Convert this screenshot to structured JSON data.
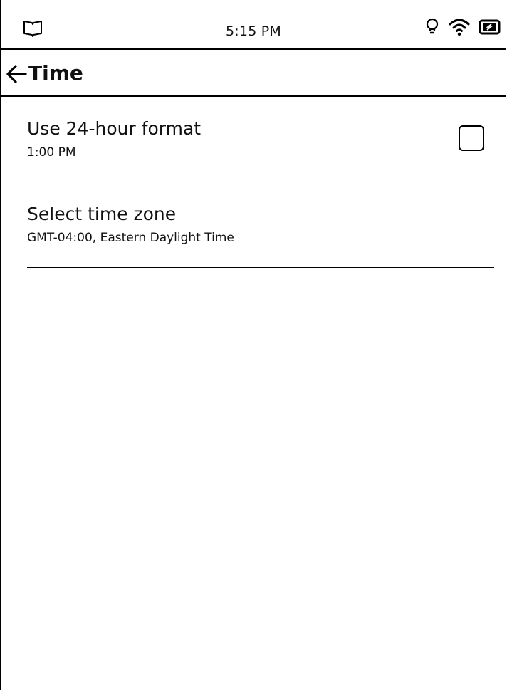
{
  "status_bar": {
    "time": "5:15 PM",
    "icons": [
      "book-icon",
      "light-bulb-icon",
      "wifi-icon",
      "battery-icon"
    ]
  },
  "header": {
    "title": "Time",
    "back_icon": "arrow-left-icon"
  },
  "settings": [
    {
      "title": "Use 24-hour format",
      "subtitle": "1:00 PM",
      "control": "checkbox",
      "checked": false
    },
    {
      "title": "Select time zone",
      "subtitle": "GMT-04:00, Eastern Daylight Time"
    }
  ]
}
